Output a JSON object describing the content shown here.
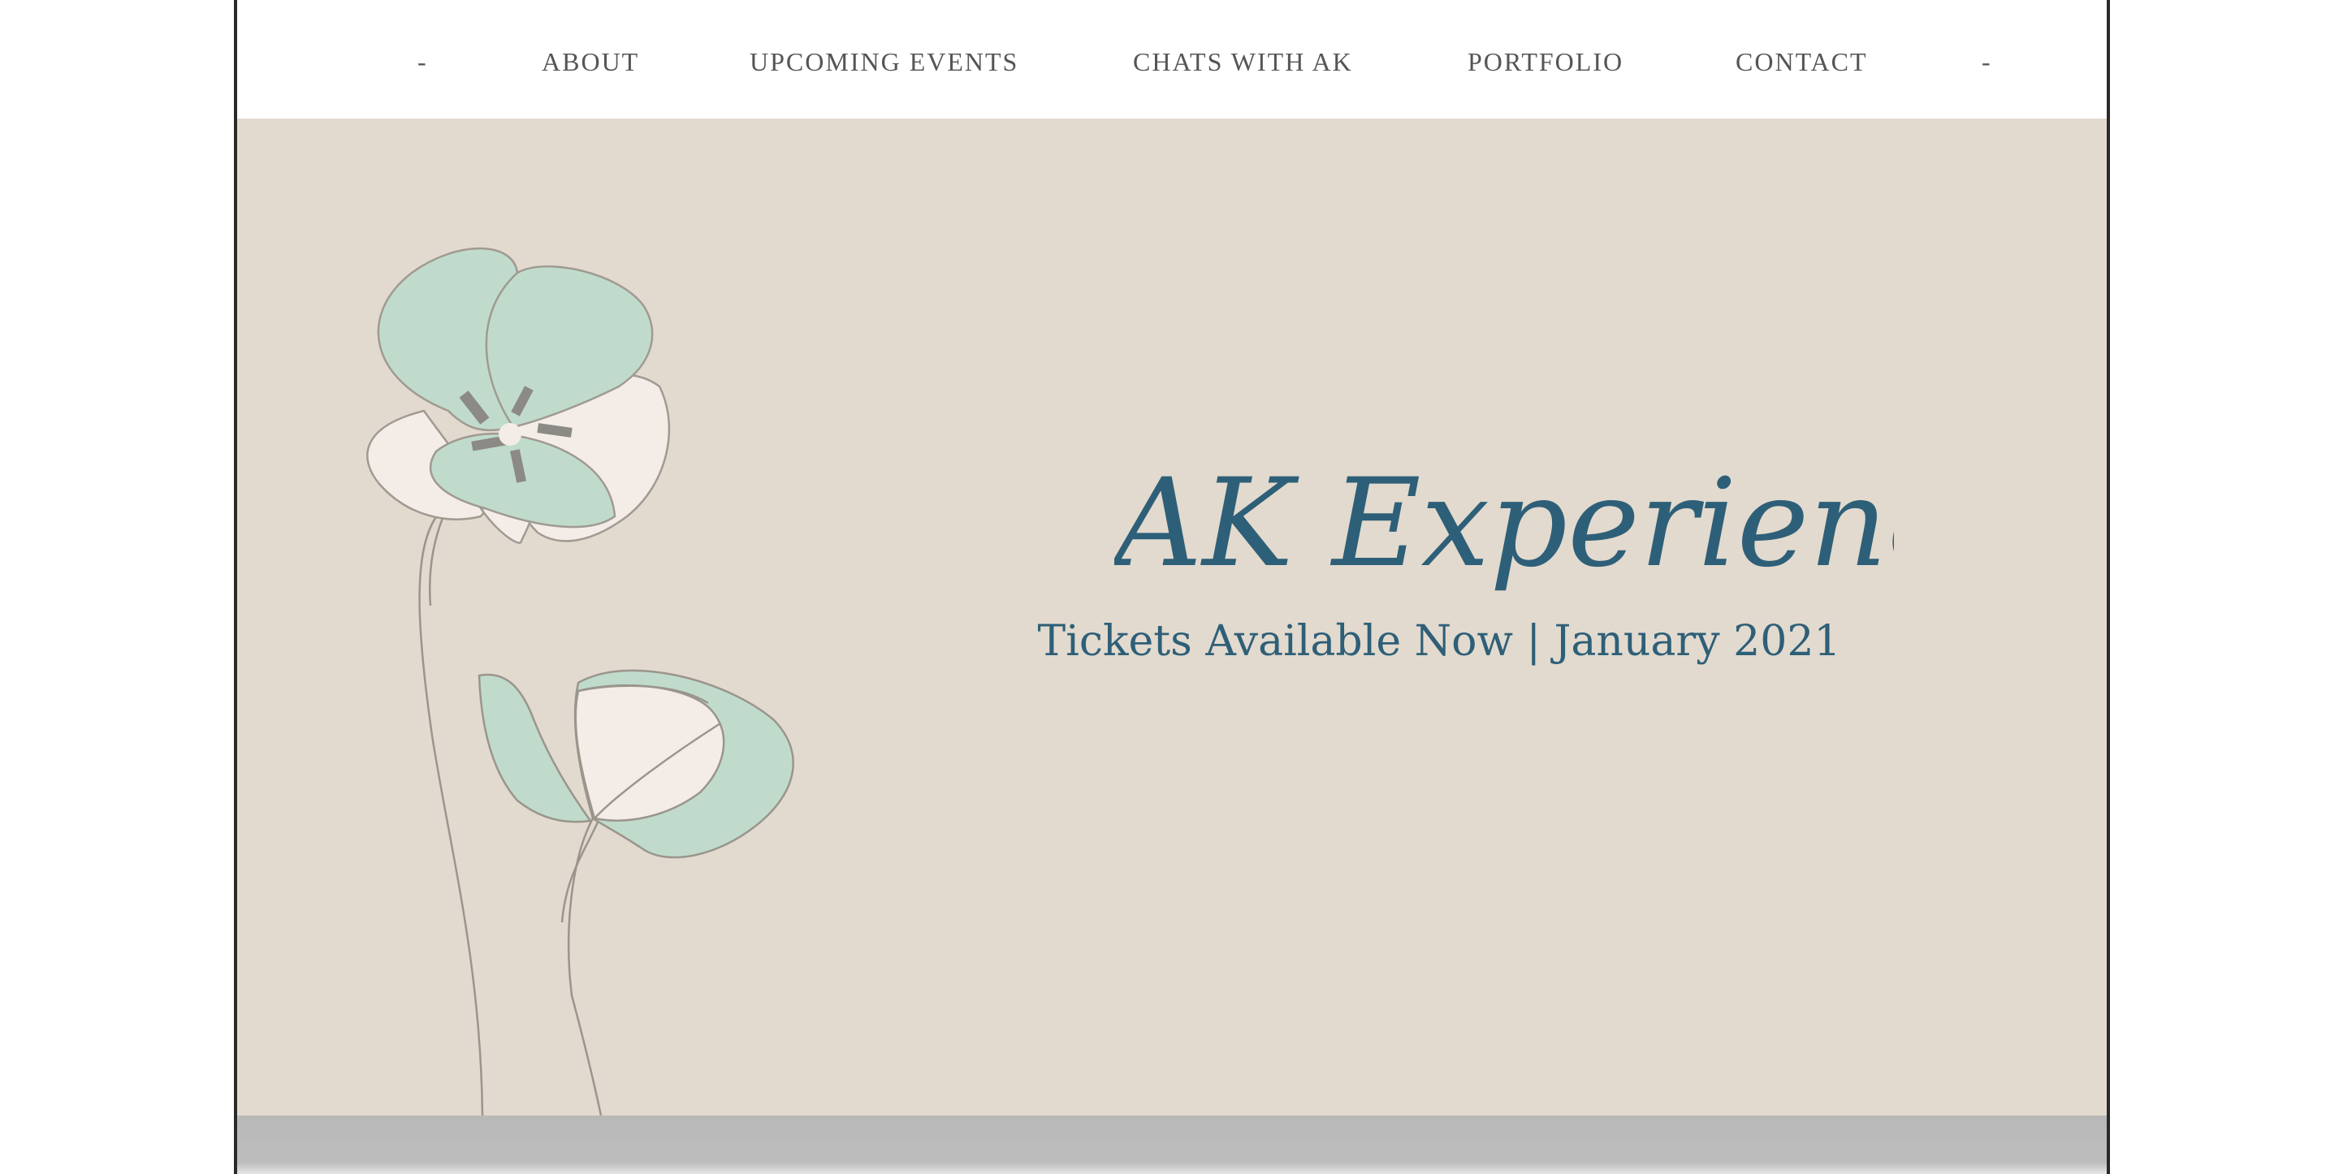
{
  "nav": {
    "items": [
      {
        "label": "-"
      },
      {
        "label": "ABOUT"
      },
      {
        "label": "UPCOMING EVENTS"
      },
      {
        "label": "CHATS WITH AK"
      },
      {
        "label": "PORTFOLIO"
      },
      {
        "label": "CONTACT"
      },
      {
        "label": "-"
      }
    ]
  },
  "hero": {
    "logo_text": "AK Experience",
    "tagline": "Tickets Available Now | January 2021"
  },
  "colors": {
    "hero_background": "#e2dace",
    "brand_teal": "#2e5f78",
    "petal_green": "#c0dbcc",
    "petal_cream": "#f3ece7",
    "stem_gray": "#9a958d"
  }
}
